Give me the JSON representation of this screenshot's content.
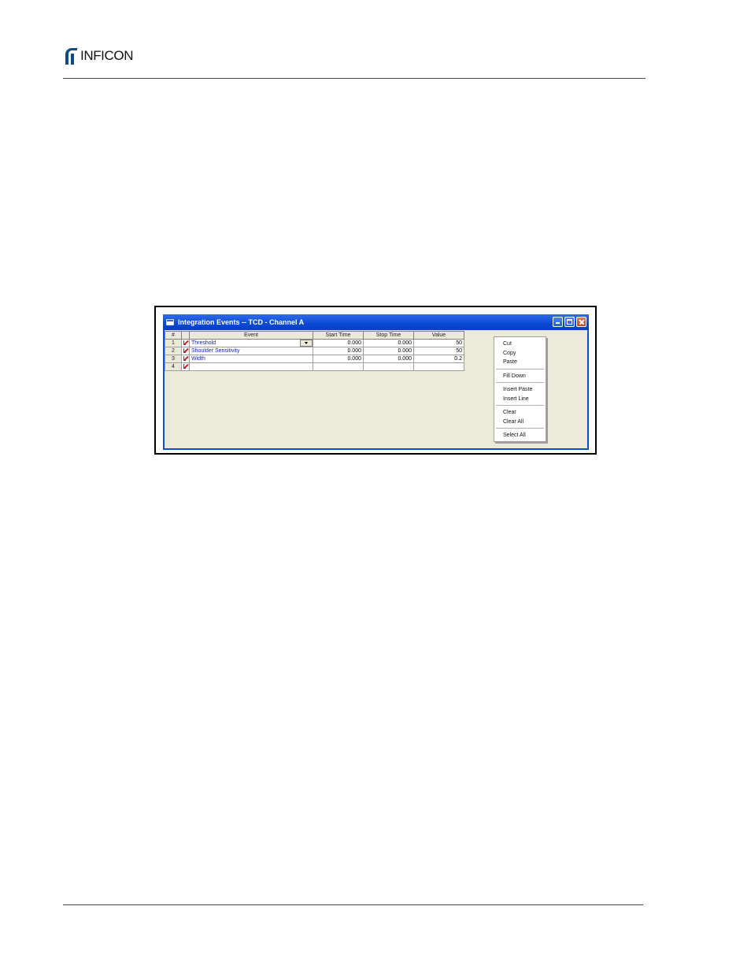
{
  "header": {
    "logo_text": "INFICON"
  },
  "window": {
    "title": "Integration Events -- TCD - Channel A",
    "columns": {
      "num": "#",
      "event": "Event",
      "start_time": "Start Time",
      "stop_time": "Stop Time",
      "value": "Value"
    },
    "rows": [
      {
        "num": "1",
        "event": "Threshold",
        "start": "0.000",
        "stop": "0.000",
        "value": "50"
      },
      {
        "num": "2",
        "event": "Shoulder Sensitivity",
        "start": "0.000",
        "stop": "0.000",
        "value": "50"
      },
      {
        "num": "3",
        "event": "Width",
        "start": "0.000",
        "stop": "0.000",
        "value": "0.2"
      },
      {
        "num": "4",
        "event": "",
        "start": "",
        "stop": "",
        "value": ""
      }
    ]
  },
  "context_menu": {
    "cut": "Cut",
    "copy": "Copy",
    "paste": "Paste",
    "fill_down": "Fill Down",
    "insert_paste": "Insert Paste",
    "insert_line": "Insert Line",
    "clear": "Clear",
    "clear_all": "Clear All",
    "select_all": "Select All"
  },
  "colors": {
    "title_bar": "#0a49d3",
    "window_bg": "#ebe9d8",
    "event_text": "#1622b8",
    "edit_icon": "#d21c1c"
  }
}
